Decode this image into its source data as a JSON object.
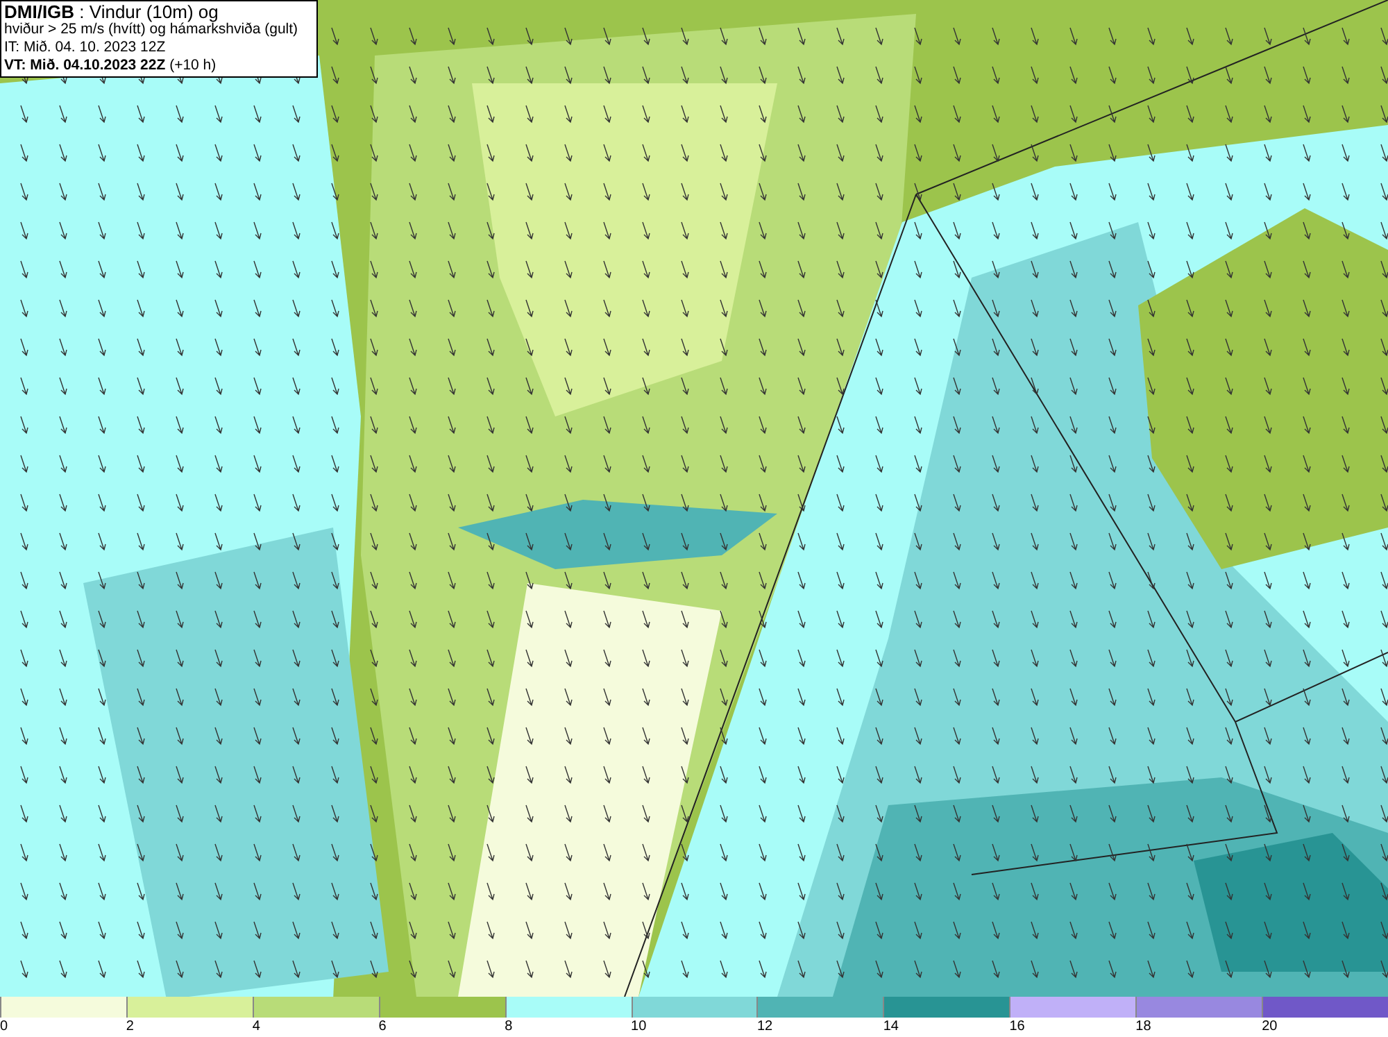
{
  "header": {
    "lines": [
      "**DMI/IGB** : Vindur (10m) og",
      "hviður > 25 m/s (hvítt) og hámarkshviða (gult)",
      "IT: Mið. 04. 10. 2023 12Z",
      "**VT: Mið. 04.10.2023 22Z** (+10 h)"
    ]
  },
  "legend": [
    {
      "label": "0",
      "color": "#f5fbdc"
    },
    {
      "label": "2",
      "color": "#d8f09a"
    },
    {
      "label": "4",
      "color": "#b8dc78"
    },
    {
      "label": "6",
      "color": "#9cc44c"
    },
    {
      "label": "8",
      "color": "#a8fcf8"
    },
    {
      "label": "10",
      "color": "#80d8d8"
    },
    {
      "label": "12",
      "color": "#50b4b4"
    },
    {
      "label": "14",
      "color": "#289494"
    },
    {
      "label": "16",
      "color": "#c0b0f8"
    },
    {
      "label": "18",
      "color": "#9888e0"
    },
    {
      "label": "20",
      "color": "#7058c8"
    }
  ]
}
